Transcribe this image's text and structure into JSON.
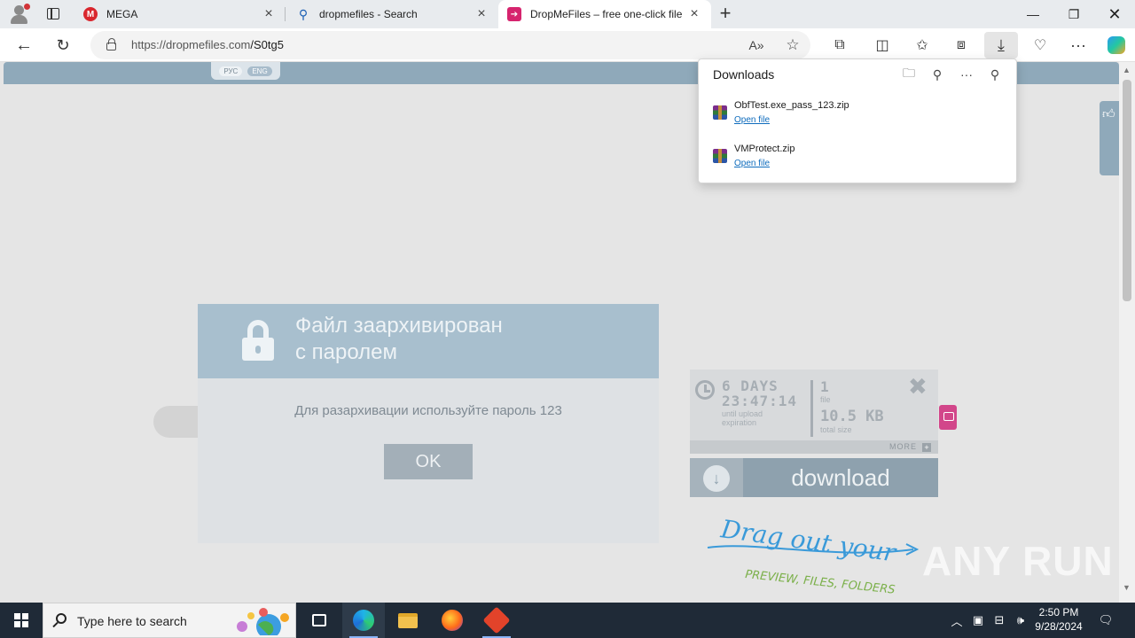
{
  "browser": {
    "tabs": [
      {
        "title": "MEGA",
        "favicon": "mega-icon",
        "active": false
      },
      {
        "title": "dropmefiles - Search",
        "favicon": "search-icon",
        "active": false
      },
      {
        "title": "DropMeFiles – free one-click file",
        "favicon": "dropmefiles-icon",
        "active": true
      }
    ],
    "url_host": "https://dropmefiles.com",
    "url_path": "/S0tg5"
  },
  "downloads": {
    "title": "Downloads",
    "items": [
      {
        "name": "ObfTest.exe_pass_123.zip",
        "action": "Open file"
      },
      {
        "name": "VMProtect.zip",
        "action": "Open file"
      }
    ]
  },
  "page": {
    "langs": [
      "РУС",
      "ENG"
    ],
    "dialog": {
      "title_line1": "Файл заархивирован",
      "title_line2": "с паролем",
      "message": "Для разархивации используйте пароль 123",
      "ok": "OK"
    },
    "info": {
      "days": "6 DAYS",
      "time": "23:47:14",
      "until1": "until upload",
      "until2": "expiration",
      "file_count": "1",
      "file_label": "file",
      "size": "10.5 KB",
      "size_label": "total size",
      "more": "MORE"
    },
    "download_label": "download",
    "drag_line1": "Drag out your",
    "drag_line2": "PREVIEW, FILES, FOLDERS",
    "watermark": "ANY RUN"
  },
  "taskbar": {
    "search_placeholder": "Type here to search",
    "time": "2:50 PM",
    "date": "9/28/2024"
  },
  "colors": {
    "page_bg": "#e5e5e5",
    "accent": "#8fa9ba",
    "taskbar": "#1f2a37"
  }
}
